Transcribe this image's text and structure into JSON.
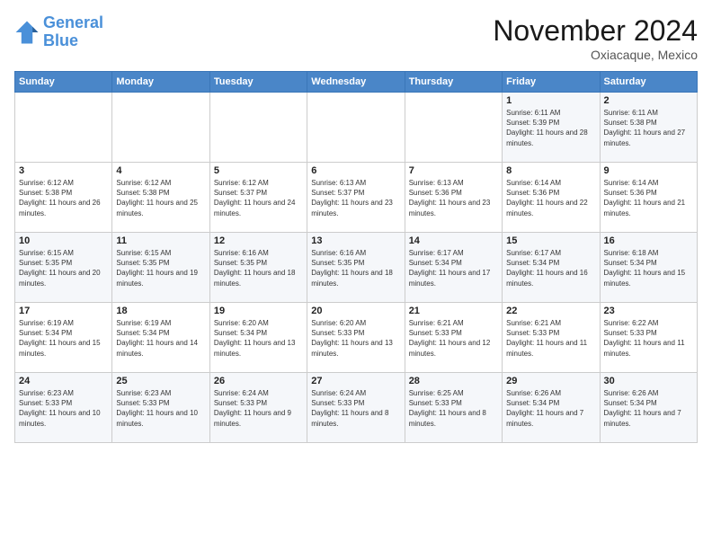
{
  "header": {
    "logo_line1": "General",
    "logo_line2": "Blue",
    "month": "November 2024",
    "location": "Oxiacaque, Mexico"
  },
  "days_of_week": [
    "Sunday",
    "Monday",
    "Tuesday",
    "Wednesday",
    "Thursday",
    "Friday",
    "Saturday"
  ],
  "weeks": [
    [
      {
        "day": "",
        "info": ""
      },
      {
        "day": "",
        "info": ""
      },
      {
        "day": "",
        "info": ""
      },
      {
        "day": "",
        "info": ""
      },
      {
        "day": "",
        "info": ""
      },
      {
        "day": "1",
        "info": "Sunrise: 6:11 AM\nSunset: 5:39 PM\nDaylight: 11 hours and 28 minutes."
      },
      {
        "day": "2",
        "info": "Sunrise: 6:11 AM\nSunset: 5:38 PM\nDaylight: 11 hours and 27 minutes."
      }
    ],
    [
      {
        "day": "3",
        "info": "Sunrise: 6:12 AM\nSunset: 5:38 PM\nDaylight: 11 hours and 26 minutes."
      },
      {
        "day": "4",
        "info": "Sunrise: 6:12 AM\nSunset: 5:38 PM\nDaylight: 11 hours and 25 minutes."
      },
      {
        "day": "5",
        "info": "Sunrise: 6:12 AM\nSunset: 5:37 PM\nDaylight: 11 hours and 24 minutes."
      },
      {
        "day": "6",
        "info": "Sunrise: 6:13 AM\nSunset: 5:37 PM\nDaylight: 11 hours and 23 minutes."
      },
      {
        "day": "7",
        "info": "Sunrise: 6:13 AM\nSunset: 5:36 PM\nDaylight: 11 hours and 23 minutes."
      },
      {
        "day": "8",
        "info": "Sunrise: 6:14 AM\nSunset: 5:36 PM\nDaylight: 11 hours and 22 minutes."
      },
      {
        "day": "9",
        "info": "Sunrise: 6:14 AM\nSunset: 5:36 PM\nDaylight: 11 hours and 21 minutes."
      }
    ],
    [
      {
        "day": "10",
        "info": "Sunrise: 6:15 AM\nSunset: 5:35 PM\nDaylight: 11 hours and 20 minutes."
      },
      {
        "day": "11",
        "info": "Sunrise: 6:15 AM\nSunset: 5:35 PM\nDaylight: 11 hours and 19 minutes."
      },
      {
        "day": "12",
        "info": "Sunrise: 6:16 AM\nSunset: 5:35 PM\nDaylight: 11 hours and 18 minutes."
      },
      {
        "day": "13",
        "info": "Sunrise: 6:16 AM\nSunset: 5:35 PM\nDaylight: 11 hours and 18 minutes."
      },
      {
        "day": "14",
        "info": "Sunrise: 6:17 AM\nSunset: 5:34 PM\nDaylight: 11 hours and 17 minutes."
      },
      {
        "day": "15",
        "info": "Sunrise: 6:17 AM\nSunset: 5:34 PM\nDaylight: 11 hours and 16 minutes."
      },
      {
        "day": "16",
        "info": "Sunrise: 6:18 AM\nSunset: 5:34 PM\nDaylight: 11 hours and 15 minutes."
      }
    ],
    [
      {
        "day": "17",
        "info": "Sunrise: 6:19 AM\nSunset: 5:34 PM\nDaylight: 11 hours and 15 minutes."
      },
      {
        "day": "18",
        "info": "Sunrise: 6:19 AM\nSunset: 5:34 PM\nDaylight: 11 hours and 14 minutes."
      },
      {
        "day": "19",
        "info": "Sunrise: 6:20 AM\nSunset: 5:34 PM\nDaylight: 11 hours and 13 minutes."
      },
      {
        "day": "20",
        "info": "Sunrise: 6:20 AM\nSunset: 5:33 PM\nDaylight: 11 hours and 13 minutes."
      },
      {
        "day": "21",
        "info": "Sunrise: 6:21 AM\nSunset: 5:33 PM\nDaylight: 11 hours and 12 minutes."
      },
      {
        "day": "22",
        "info": "Sunrise: 6:21 AM\nSunset: 5:33 PM\nDaylight: 11 hours and 11 minutes."
      },
      {
        "day": "23",
        "info": "Sunrise: 6:22 AM\nSunset: 5:33 PM\nDaylight: 11 hours and 11 minutes."
      }
    ],
    [
      {
        "day": "24",
        "info": "Sunrise: 6:23 AM\nSunset: 5:33 PM\nDaylight: 11 hours and 10 minutes."
      },
      {
        "day": "25",
        "info": "Sunrise: 6:23 AM\nSunset: 5:33 PM\nDaylight: 11 hours and 10 minutes."
      },
      {
        "day": "26",
        "info": "Sunrise: 6:24 AM\nSunset: 5:33 PM\nDaylight: 11 hours and 9 minutes."
      },
      {
        "day": "27",
        "info": "Sunrise: 6:24 AM\nSunset: 5:33 PM\nDaylight: 11 hours and 8 minutes."
      },
      {
        "day": "28",
        "info": "Sunrise: 6:25 AM\nSunset: 5:33 PM\nDaylight: 11 hours and 8 minutes."
      },
      {
        "day": "29",
        "info": "Sunrise: 6:26 AM\nSunset: 5:34 PM\nDaylight: 11 hours and 7 minutes."
      },
      {
        "day": "30",
        "info": "Sunrise: 6:26 AM\nSunset: 5:34 PM\nDaylight: 11 hours and 7 minutes."
      }
    ]
  ]
}
